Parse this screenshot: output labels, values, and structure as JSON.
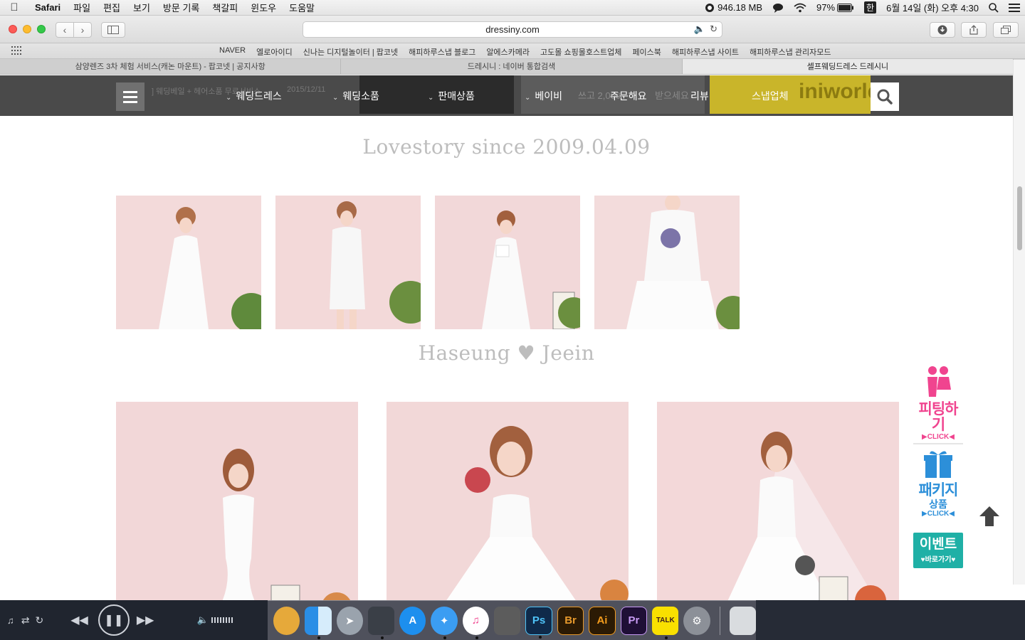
{
  "menubar": {
    "app": "Safari",
    "items": [
      "파일",
      "편집",
      "보기",
      "방문 기록",
      "책갈피",
      "윈도우",
      "도움말"
    ],
    "memory": "946.18 MB",
    "battery": "97%",
    "input_method": "한",
    "datetime": "6월 14일 (화) 오후 4:30"
  },
  "toolbar": {
    "url": "dressiny.com"
  },
  "bookmarks": [
    "NAVER",
    "엘로아이디",
    "신나는 디지털놀이터 | 팝코넷",
    "해피하루스냅 블로그",
    "알에스카메라",
    "고도몰 쇼핑몰호스트업체",
    "페이스북",
    "해피하루스냅 사이트",
    "해피하루스냅 관리자모드"
  ],
  "tabs": [
    {
      "title": "삼양렌즈 3차 체험 서비스(캐논 마운트) - 팝코넷 | 공지사항"
    },
    {
      "title": "드레시니 : 네이버 통합검색"
    },
    {
      "title": "셀프웨딩드레스 드레시니"
    }
  ],
  "nav": {
    "items": [
      "웨딩드레스",
      "웨딩소품",
      "판매상품",
      "베이비",
      "주문해요",
      "리뷰",
      "스냅업체"
    ],
    "bg_text": {
      "a": "2015/12/11",
      "b": "] 웨딩베일 + 헤어소품 무료서비스",
      "c": "쓰고 2,000",
      "d": "받으세요",
      "e": "iniworld4"
    }
  },
  "sections": {
    "lovestory": "Lovestory since 2009.04.09",
    "couple_left": "Haseung",
    "couple_right": "Jeein",
    "heart": "♥"
  },
  "side_badges": {
    "fitting": "피팅하기",
    "fitting_click": "▶CLICK◀",
    "package": "패키지",
    "package_sub": "상품",
    "package_click": "▶CLICK◀",
    "event": "이벤트",
    "event_sub": "♥바로가기♥"
  },
  "dock": {
    "ps": "Ps",
    "br": "Br",
    "ai": "Ai",
    "pr": "Pr",
    "talk": "TALK"
  },
  "colors": {
    "nav_bg": "#4a4a4a",
    "photo_bg": "#f2d9da",
    "badge_pink": "#f0448f",
    "badge_blue": "#2c8fd9",
    "badge_teal": "#1fb0a6"
  }
}
